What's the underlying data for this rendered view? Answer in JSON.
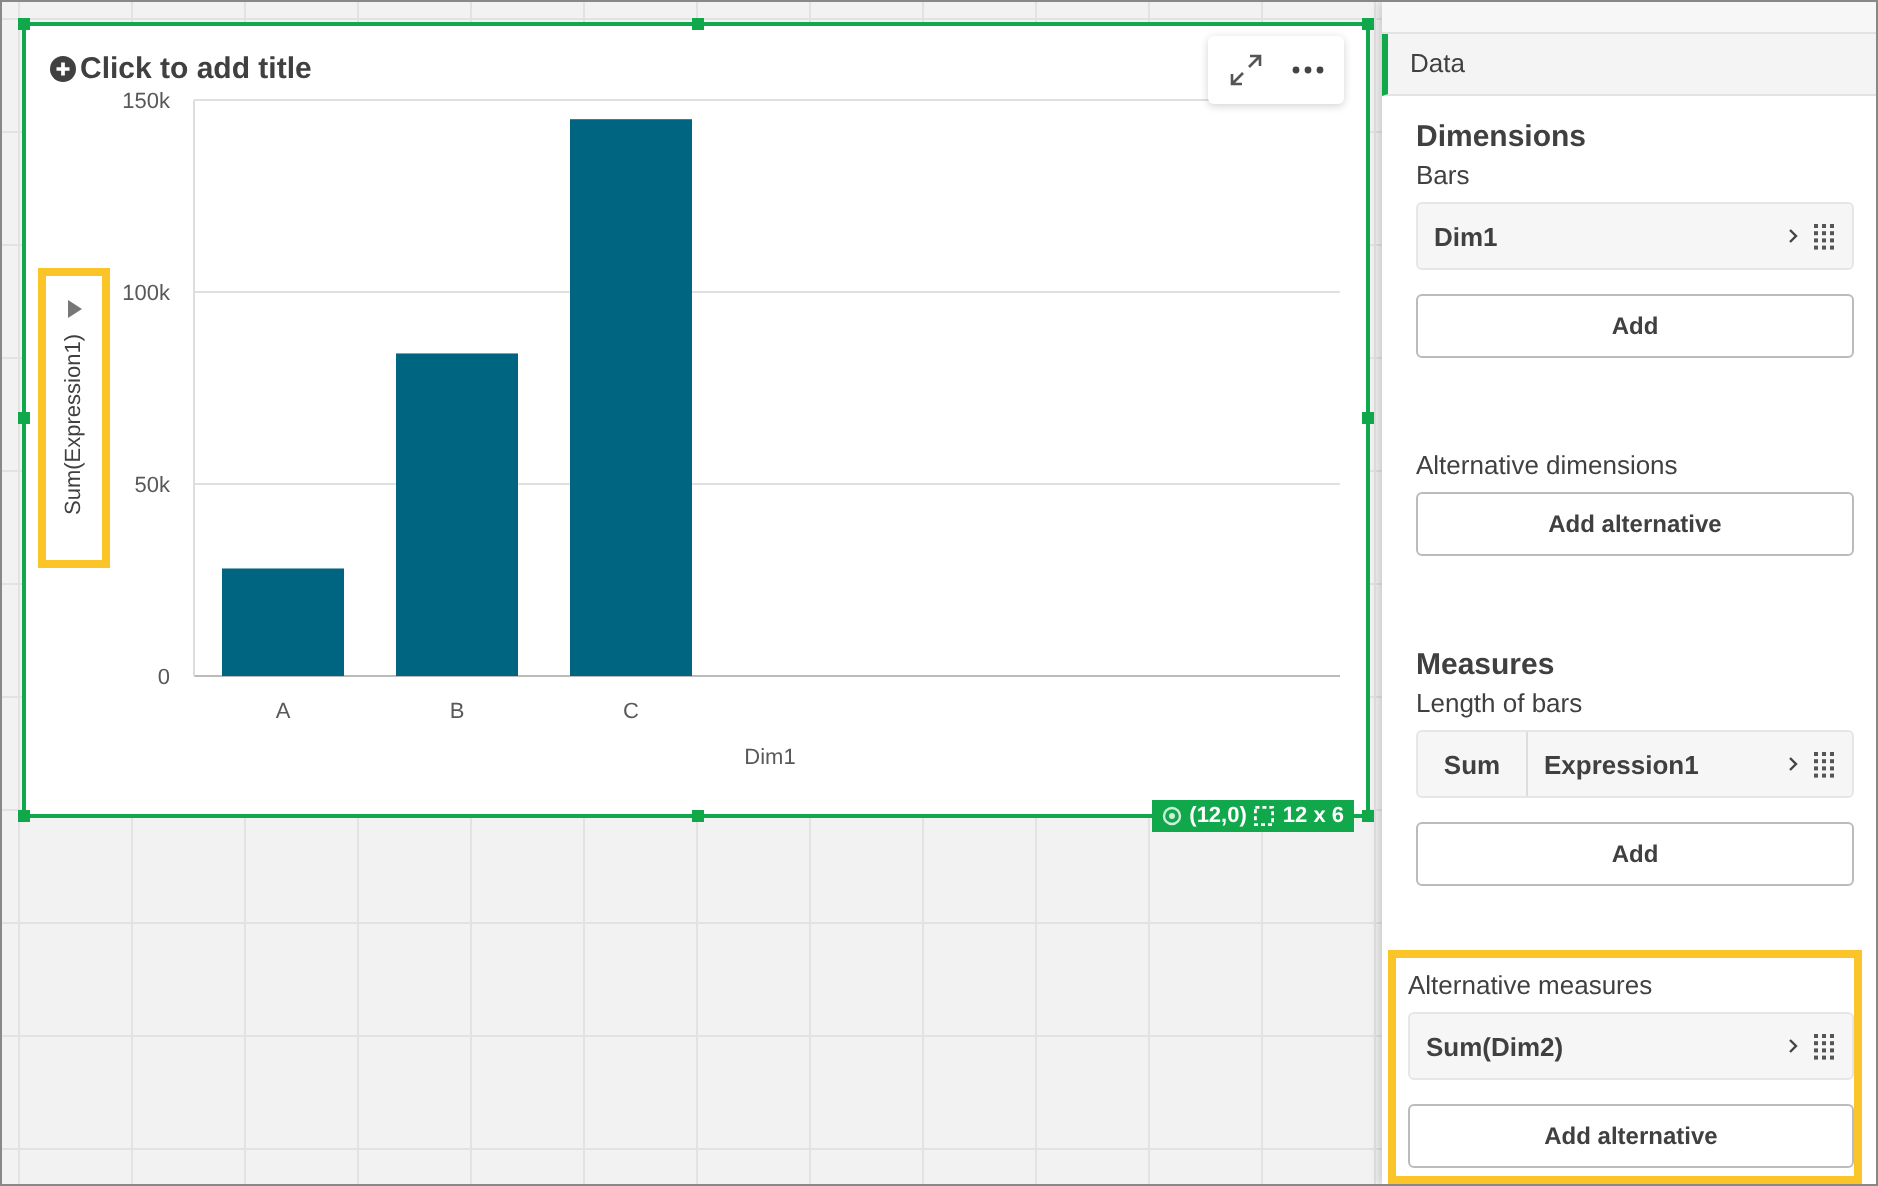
{
  "chart": {
    "title_placeholder": "Click to add title",
    "y_axis_highlighted": true,
    "chart_data": {
      "type": "bar",
      "xlabel": "Dim1",
      "ylabel": "Sum(Expression1)",
      "categories": [
        "A",
        "B",
        "C"
      ],
      "series": [
        {
          "color": "#006580",
          "values": [
            28000,
            84000,
            145000
          ]
        }
      ],
      "ylim": [
        0,
        150000
      ],
      "yticks": [
        {
          "value": 0,
          "label": "0"
        },
        {
          "value": 50000,
          "label": "50k"
        },
        {
          "value": 100000,
          "label": "100k"
        },
        {
          "value": 150000,
          "label": "150k"
        }
      ]
    }
  },
  "selection_badge": {
    "position": "(12,0)",
    "size": "12 x 6"
  },
  "panel": {
    "tabs": [
      {
        "label": "Data",
        "selected": true
      }
    ],
    "sections": [
      {
        "heading": "Dimensions",
        "subheading": "Bars",
        "items": [
          {
            "kind": "field",
            "label": "Dim1"
          }
        ],
        "button": "Add",
        "highlighted": false
      },
      {
        "subheading": "Alternative dimensions",
        "button": "Add alternative",
        "highlighted": false
      },
      {
        "heading": "Measures",
        "subheading": "Length of bars",
        "items": [
          {
            "kind": "measure",
            "aggregation": "Sum",
            "label": "Expression1"
          }
        ],
        "button": "Add",
        "highlighted": false
      },
      {
        "subheading": "Alternative measures",
        "items": [
          {
            "kind": "field",
            "label": "Sum(Dim2)"
          }
        ],
        "button": "Add alternative",
        "highlighted": true
      }
    ]
  }
}
